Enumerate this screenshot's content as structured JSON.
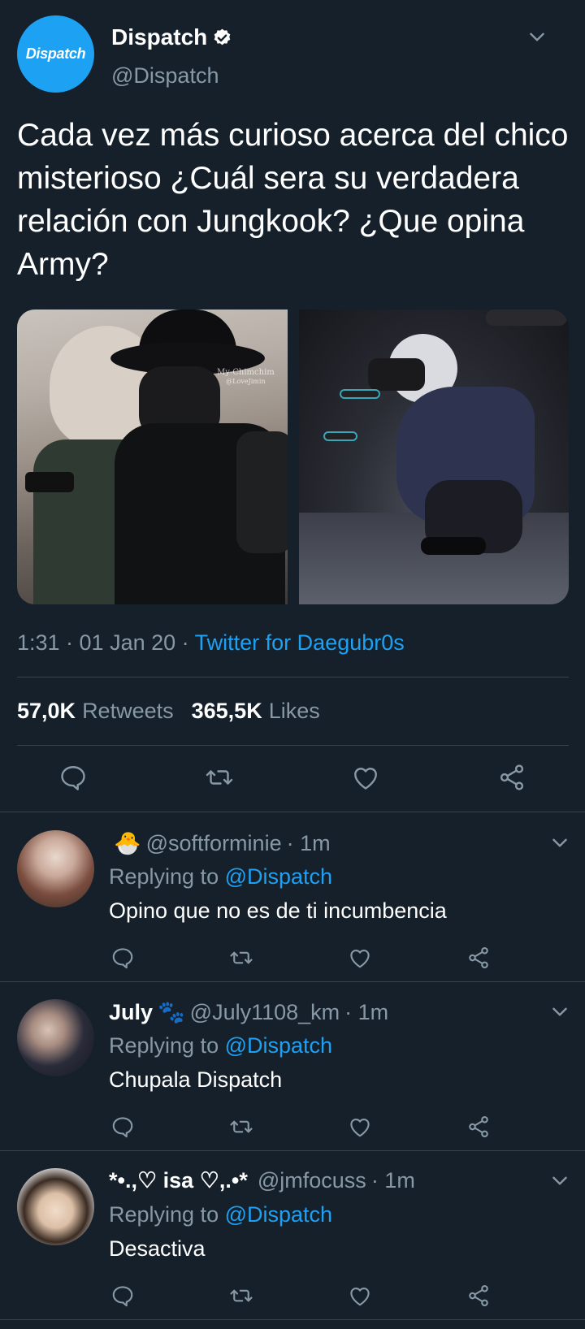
{
  "tweet": {
    "avatar_text": "Dispatch",
    "display_name": "Dispatch",
    "handle": "@Dispatch",
    "text": "Cada vez más curioso acerca del chico misterioso ¿Cuál sera su verdadera relación con Jungkook? ¿Que opina Army?",
    "time": "1:31 · 01 Jan 20 · ",
    "source": "Twitter for Daegubr0s",
    "retweets_count": "57,0K",
    "retweets_label": "Retweets",
    "likes_count": "365,5K",
    "likes_label": "Likes",
    "photo_watermark": "My-Chimchim",
    "photo_watermark_sub": "@LoveJimin"
  },
  "replies": [
    {
      "name": "",
      "emoji": "🐣",
      "handle": "@softforminie",
      "time": "· 1m",
      "replying_prefix": "Replying to ",
      "replying_to": "@Dispatch",
      "text": "Opino que no es de ti incumbencia"
    },
    {
      "name": "July",
      "emoji": "🐾",
      "handle": "@July1108_km",
      "time": "· 1m",
      "replying_prefix": "Replying to ",
      "replying_to": "@Dispatch",
      "text": "Chupala Dispatch"
    },
    {
      "name": "*•.,♡ isa ♡,.•*",
      "emoji": "",
      "handle": "@jmfocuss",
      "time": "· 1m",
      "replying_prefix": "Replying to ",
      "replying_to": "@Dispatch",
      "text": "Desactiva"
    }
  ],
  "colors": {
    "background": "#15202b",
    "accent": "#1da1f2",
    "secondary_text": "#8899a6",
    "divider": "#38444d"
  },
  "icons": [
    "verified-badge-icon",
    "chevron-down-icon",
    "reply-icon",
    "retweet-icon",
    "like-icon",
    "share-icon"
  ]
}
